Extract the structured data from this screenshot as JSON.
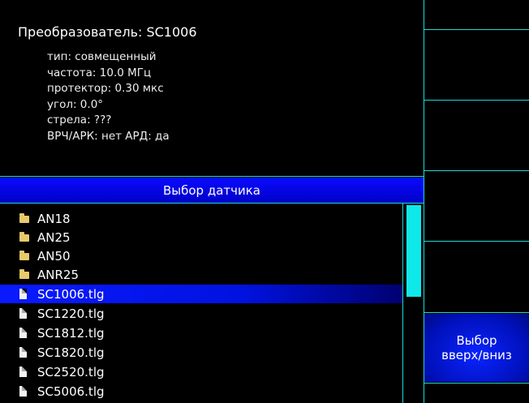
{
  "converter": {
    "title": "Преобразователь: SC1006",
    "lines": [
      "тип: совмещенный",
      "частота: 10.0 МГц",
      "протектор: 0.30 мкс",
      "угол: 0.0°",
      "стрела: ???",
      "ВРЧ/АРК: нет  АРД: да"
    ]
  },
  "list_header": "Выбор датчика",
  "files": [
    {
      "label": "AN18",
      "type": "folder"
    },
    {
      "label": "AN25",
      "type": "folder"
    },
    {
      "label": "AN50",
      "type": "folder"
    },
    {
      "label": "ANR25",
      "type": "folder"
    },
    {
      "label": "SC1006.tlg",
      "type": "file",
      "selected": true
    },
    {
      "label": "SC1220.tlg",
      "type": "file"
    },
    {
      "label": "SC1812.tlg",
      "type": "file"
    },
    {
      "label": "SC1820.tlg",
      "type": "file"
    },
    {
      "label": "SC2520.tlg",
      "type": "file"
    },
    {
      "label": "SC5006.tlg",
      "type": "file"
    }
  ],
  "side_button": {
    "line1": "Выбор",
    "line2": "вверх/вниз"
  },
  "colors": {
    "accent": "#1fd7d7",
    "selection": "#0a1aff",
    "folder": "#e8c96a"
  }
}
